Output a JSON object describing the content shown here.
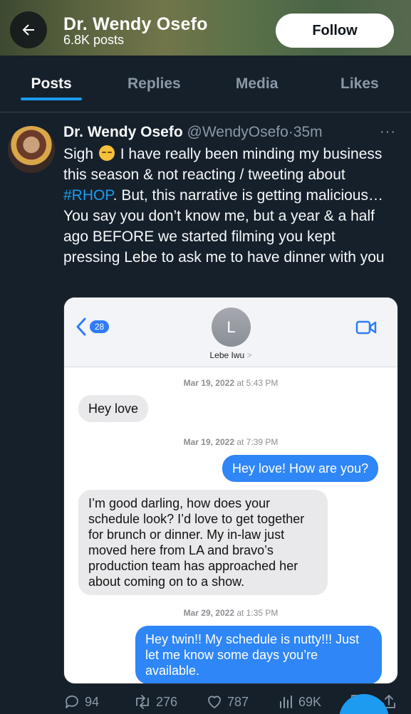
{
  "header": {
    "title": "Dr. Wendy Osefo",
    "posts_count": "6.8K posts",
    "follow_label": "Follow"
  },
  "tabs": [
    {
      "label": "Posts",
      "active": true
    },
    {
      "label": "Replies",
      "active": false
    },
    {
      "label": "Media",
      "active": false
    },
    {
      "label": "Likes",
      "active": false
    }
  ],
  "tweet": {
    "name": "Dr. Wendy Osefo",
    "handle": "@WendyOsefo",
    "separator": "·",
    "time": "35m",
    "more": "···",
    "text_1": "Sigh ",
    "text_2": " I have really been minding my business this season & not reacting / tweeting about ",
    "hashtag": "#RHOP",
    "text_3": ". But, this narrative is getting malicious…You say you don’t know me, but a year & a half ago BEFORE we started filming you kept pressing Lebe to ask me to have dinner with you"
  },
  "imessage": {
    "back_badge": "28",
    "contact_initial": "L",
    "contact_name": "Lebe Iwu",
    "contact_chevron": ">",
    "messages": [
      {
        "kind": "timestamp",
        "date": "Mar 19, 2022",
        "at": "at 5:43 PM"
      },
      {
        "kind": "in",
        "text": "Hey love"
      },
      {
        "kind": "timestamp",
        "date": "Mar 19, 2022",
        "at": "at 7:39 PM"
      },
      {
        "kind": "out",
        "text": "Hey love! How are you?"
      },
      {
        "kind": "in",
        "text": "I’m good darling, how does your schedule look? I’d love to get together for brunch or dinner. My in-law just moved here from LA and bravo’s production team has approached her about coming on to a show."
      },
      {
        "kind": "timestamp",
        "date": "Mar 29, 2022",
        "at": "at 1:35 PM"
      },
      {
        "kind": "out",
        "text": "Hey twin!! My schedule is nutty!!! Just let me know some days you’re available."
      }
    ]
  },
  "actions": {
    "replies": "94",
    "reposts": "276",
    "likes": "787",
    "views": "69K"
  },
  "colors": {
    "background": "#15202b",
    "accent": "#1d9bf0",
    "imessage_blue": "#2f86f6"
  },
  "icons": [
    "back-arrow-icon",
    "more-icon",
    "chevron-left-icon",
    "video-camera-icon",
    "reply-icon",
    "repost-icon",
    "heart-icon",
    "views-icon",
    "bookmark-icon",
    "share-icon"
  ]
}
